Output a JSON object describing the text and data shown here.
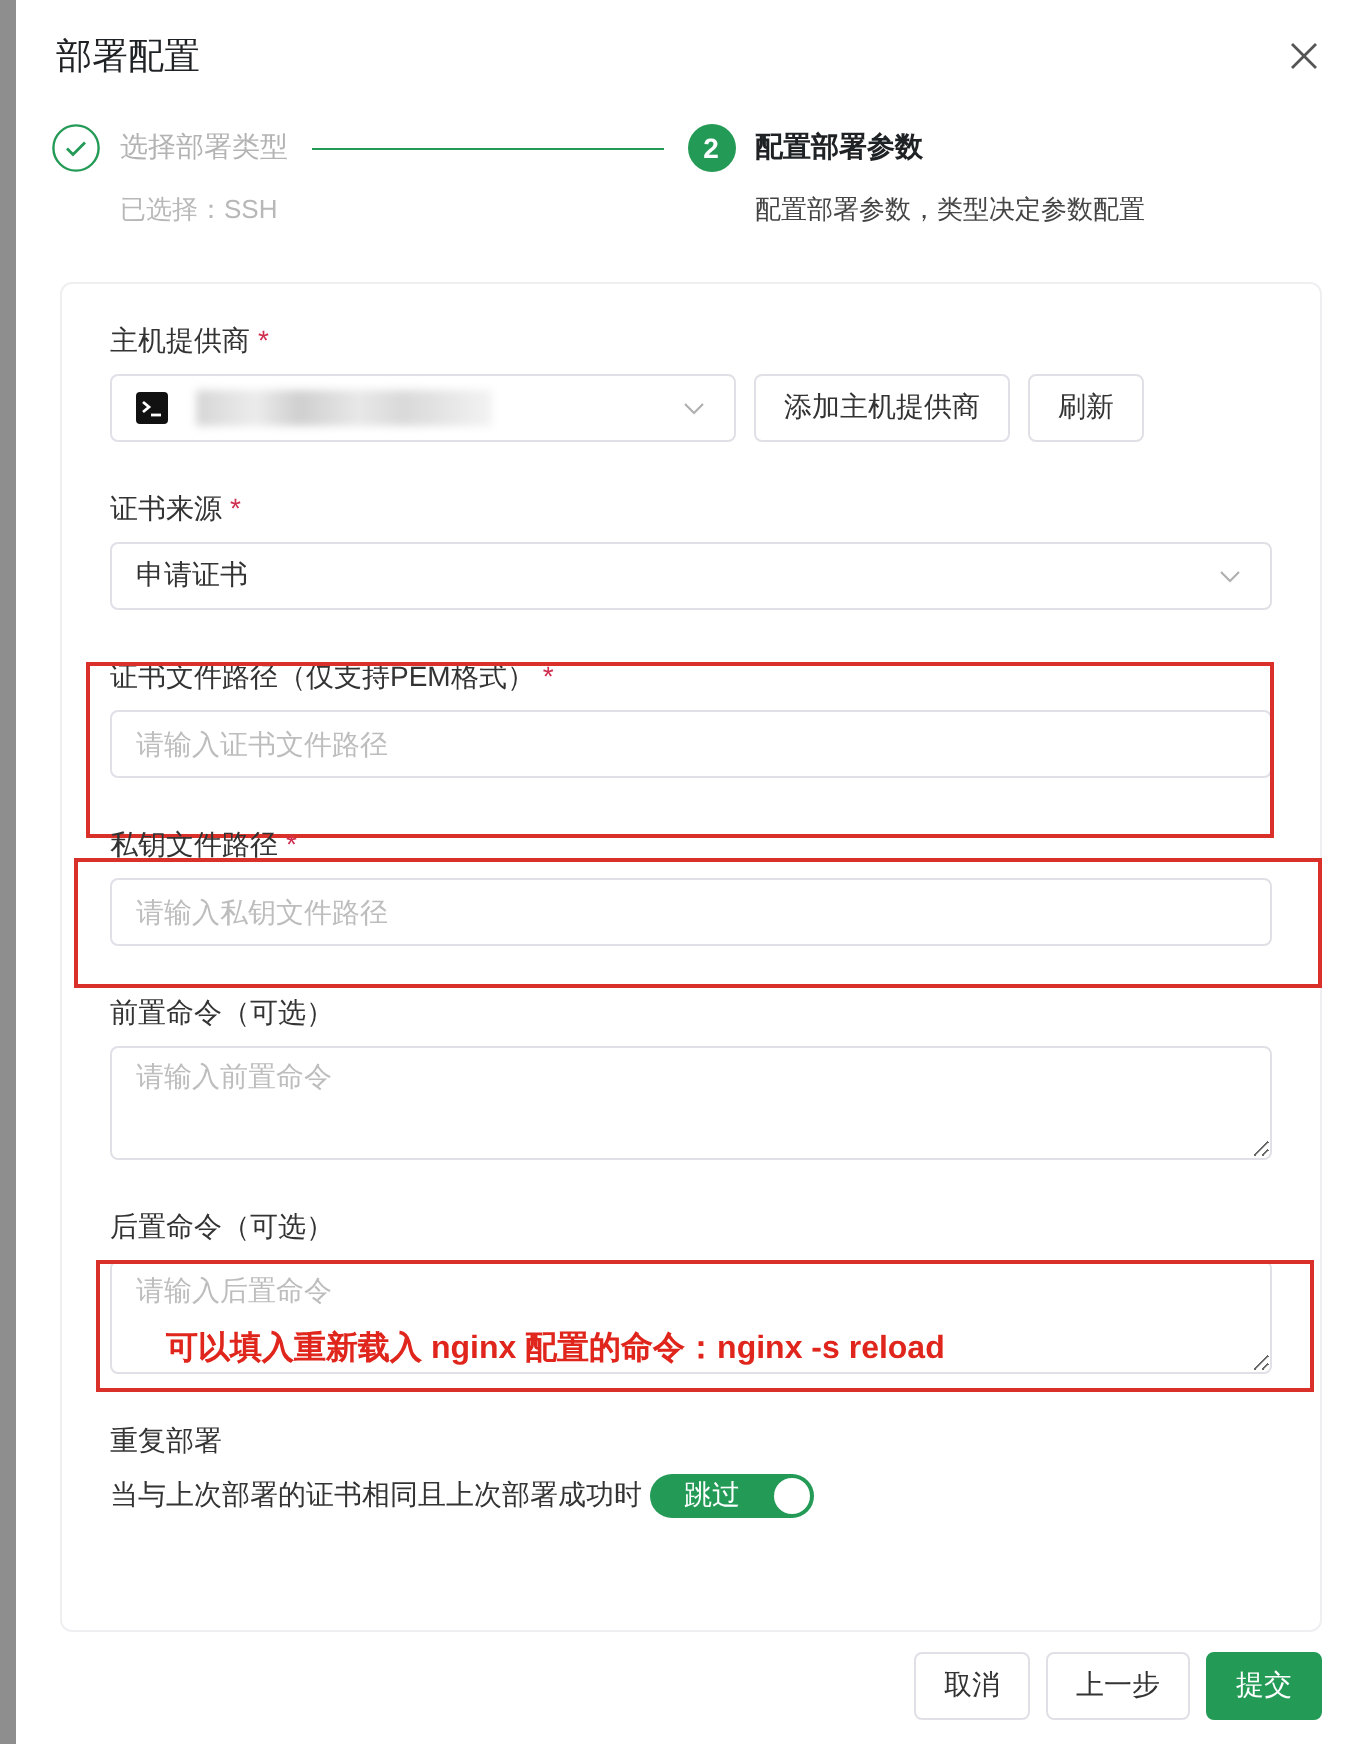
{
  "dialog": {
    "title": "部署配置"
  },
  "steps": [
    {
      "finished": true,
      "title": "选择部署类型",
      "description": "已选择：SSH"
    },
    {
      "finished": false,
      "number": "2",
      "title": "配置部署参数",
      "description": "配置部署参数，类型决定参数配置"
    }
  ],
  "fields": [
    {
      "kind": "provider-select",
      "label": "主机提供商",
      "required_mark": "*",
      "redacted": true,
      "buttons": [
        "添加主机提供商",
        "刷新"
      ]
    },
    {
      "kind": "select",
      "label": "证书来源",
      "required_mark": "*",
      "value": "申请证书"
    },
    {
      "kind": "input",
      "label": "证书文件路径（仅支持PEM格式）",
      "required_mark": "*",
      "placeholder": "请输入证书文件路径",
      "highlighted": true
    },
    {
      "kind": "input",
      "label": "私钥文件路径",
      "required_mark": "*",
      "placeholder": "请输入私钥文件路径",
      "highlighted": true
    },
    {
      "kind": "textarea",
      "label": "前置命令（可选）",
      "placeholder": "请输入前置命令"
    },
    {
      "kind": "textarea",
      "label": "后置命令（可选）",
      "placeholder": "请输入后置命令",
      "highlighted": true,
      "note": "可以填入重新载入 nginx 配置的命令：nginx -s reload"
    },
    {
      "kind": "switch",
      "label": "重复部署",
      "text": "当与上次部署的证书相同且上次部署成功时",
      "on": true,
      "switch_label": "跳过"
    }
  ],
  "footer_buttons": [
    {
      "label": "取消",
      "kind": "default"
    },
    {
      "label": "上一步",
      "kind": "default"
    },
    {
      "label": "提交",
      "kind": "primary"
    }
  ]
}
